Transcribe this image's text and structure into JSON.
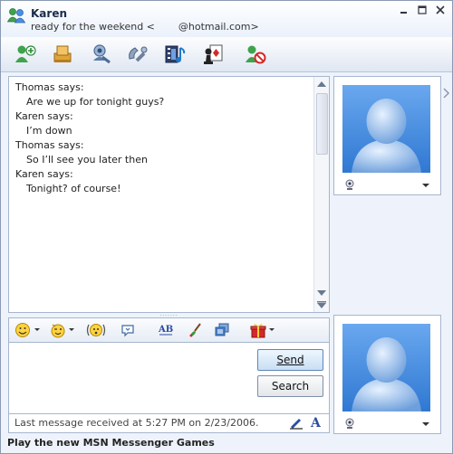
{
  "window": {
    "contact_name": "Karen",
    "status_message_part1": "ready for the weekend <",
    "status_message_part2": "@hotmail.com>",
    "controls": [
      "minimize",
      "maximize",
      "close"
    ]
  },
  "toolbar": {
    "icons": [
      "invite-contact-icon",
      "send-files-icon",
      "start-video-call-icon",
      "start-voice-call-icon",
      "activities-icon",
      "games-icon",
      "block-icon"
    ]
  },
  "history": {
    "lines": [
      {
        "type": "sender",
        "text": "Thomas says:"
      },
      {
        "type": "msg",
        "text": "Are we up for tonight guys?"
      },
      {
        "type": "sender",
        "text": "Karen says:"
      },
      {
        "type": "msg",
        "text": "I’m down"
      },
      {
        "type": "sender",
        "text": "Thomas says:"
      },
      {
        "type": "msg",
        "text": "So I’ll see you later then"
      },
      {
        "type": "sender",
        "text": "Karen says:"
      },
      {
        "type": "msg",
        "text": "Tonight? of course!"
      }
    ]
  },
  "format_toolbar": {
    "icons": [
      "emoticon-icon",
      "wink-icon",
      "nudge-icon",
      "voice-clip-icon",
      "font-icon",
      "background-icon",
      "send-picture-icon",
      "gift-icon"
    ]
  },
  "compose": {
    "value": "",
    "send_label": "Send",
    "search_label": "Search"
  },
  "status_bar": {
    "text": "Last message received at 5:27 PM on 2/23/2006."
  },
  "footer": {
    "link_text": "Play the new MSN Messenger Games"
  },
  "colors": {
    "accent": "#3d7fd6",
    "window_bg": "#eef3fb",
    "border": "#a6b6ce"
  }
}
